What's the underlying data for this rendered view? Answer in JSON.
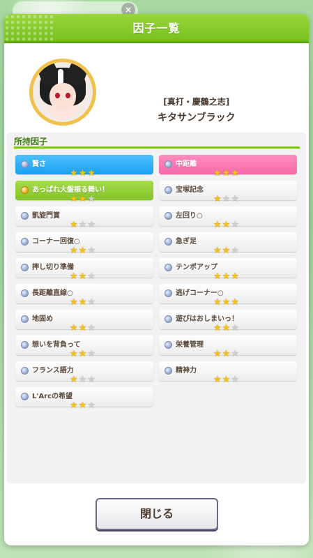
{
  "dialog": {
    "title": "因子一覧",
    "close_label": "閉じる"
  },
  "character": {
    "title": "[真打・慶鶴之志]",
    "name": "キタサンブラック"
  },
  "section": {
    "label": "所持因子"
  },
  "factors_left": [
    {
      "name": "賢さ",
      "stars": 3,
      "style": "blue",
      "icon": "blue-orb-icon"
    },
    {
      "name": "あっぱれ大盤振る舞い！",
      "stars": 2,
      "style": "green",
      "icon": "gold-orb-icon"
    },
    {
      "name": "凱旋門賞",
      "stars": 1,
      "style": "white",
      "icon": "blue-orb-icon"
    },
    {
      "name": "コーナー回復○",
      "stars": 2,
      "style": "white",
      "icon": "blue-orb-icon"
    },
    {
      "name": "押し切り準備",
      "stars": 2,
      "style": "white",
      "icon": "blue-orb-icon"
    },
    {
      "name": "長距離直線○",
      "stars": 2,
      "style": "white",
      "icon": "blue-orb-icon"
    },
    {
      "name": "地固め",
      "stars": 2,
      "style": "white",
      "icon": "blue-orb-icon"
    },
    {
      "name": "想いを背負って",
      "stars": 2,
      "style": "white",
      "icon": "blue-orb-icon"
    },
    {
      "name": "フランス語力",
      "stars": 1,
      "style": "white",
      "icon": "blue-orb-icon"
    },
    {
      "name": "L'Arcの希望",
      "stars": 2,
      "style": "white",
      "icon": "blue-orb-icon"
    }
  ],
  "factors_right": [
    {
      "name": "中距離",
      "stars": 3,
      "style": "pink",
      "icon": "blue-orb-icon"
    },
    {
      "name": "宝塚記念",
      "stars": 1,
      "style": "white",
      "icon": "blue-orb-icon"
    },
    {
      "name": "左回り○",
      "stars": 2,
      "style": "white",
      "icon": "blue-orb-icon"
    },
    {
      "name": "急ぎ足",
      "stars": 2,
      "style": "white",
      "icon": "blue-orb-icon"
    },
    {
      "name": "テンポアップ",
      "stars": 3,
      "style": "white",
      "icon": "blue-orb-icon"
    },
    {
      "name": "逃げコーナー○",
      "stars": 3,
      "style": "white",
      "icon": "blue-orb-icon"
    },
    {
      "name": "遊びはおしまいっ！",
      "stars": 2,
      "style": "white",
      "icon": "blue-orb-icon"
    },
    {
      "name": "栄養管理",
      "stars": 2,
      "style": "white",
      "icon": "blue-orb-icon"
    },
    {
      "name": "精神力",
      "stars": 2,
      "style": "white",
      "icon": "blue-orb-icon"
    }
  ],
  "colors": {
    "header_green": "#77c11f",
    "stat_blue": "#1aa1f0",
    "aptitude_pink": "#f56aa8",
    "unique_green": "#82c32a",
    "star_gold": "#f4c21c"
  }
}
